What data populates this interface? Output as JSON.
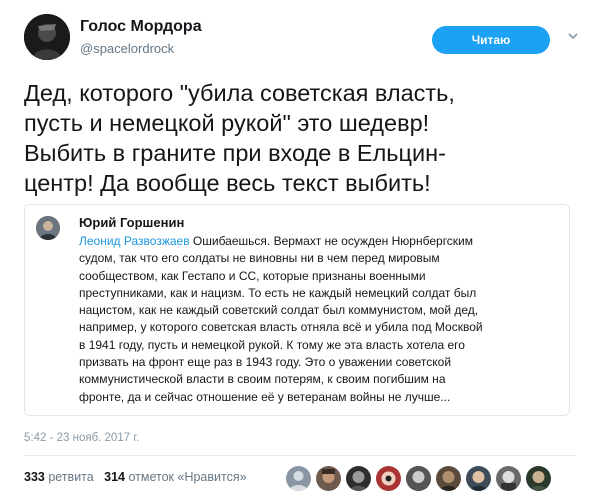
{
  "account": {
    "name": "Голос Мордора",
    "handle": "@spacelordrock",
    "follow_label": "Читаю"
  },
  "tweet": {
    "lines": [
      "Дед, которого \"убила советская власть,",
      "пусть и немецкой рукой\" это шедевр!",
      "Выбить в граните при входе в Ельцин-",
      "центр! Да вообще весь текст выбить!"
    ]
  },
  "quoted": {
    "author": "Юрий Горшенин",
    "mention": "Леонид Развозжаев",
    "lines": [
      " Ошибаешься. Вермахт не осужден Нюрнбергским",
      "судом, так что его солдаты не виновны ни в чем перед мировым",
      "сообществом, как Гестапо и СС, которые признаны военными",
      "преступниками, как и нацизм. То есть не каждый немецкий солдат был",
      "нацистом, как не каждый советский солдат был коммунистом, мой дед,",
      "например, у которого советская власть отняла всё и убила под Москвой",
      "в 1941 году, пусть и немецкой рукой. К тому же эта власть хотела его",
      "призвать на фронт еще раз в 1943 году. Это о уважении советской",
      "коммунистической власти в своим потерям, к своим погибшим на",
      "фронте, да и сейчас отношение её у ветеранам войны не лучше..."
    ]
  },
  "timestamp": "5:42 - 23 нояб. 2017 г.",
  "stats": {
    "retweets_count": "333",
    "retweets_label": "ретвита",
    "likes_count": "314",
    "likes_label": "отметок «Нравится»"
  },
  "liker_avatars": [
    "avatar-1",
    "avatar-2",
    "avatar-3",
    "avatar-4",
    "avatar-5",
    "avatar-6",
    "avatar-7",
    "avatar-8",
    "avatar-9"
  ],
  "colors": {
    "accent": "#1da1f2",
    "mention": "#1b95e0",
    "secondary_text": "#657786"
  }
}
